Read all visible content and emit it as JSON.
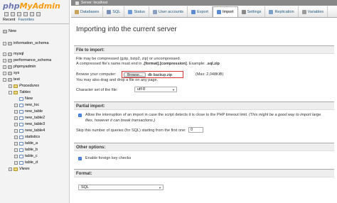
{
  "sidebar": {
    "logo_php": "php",
    "logo_myadmin": "MyAdmin",
    "tab_recent": "Recent",
    "tab_favorites": "Favorites",
    "items": [
      {
        "label": "New",
        "kind": "new"
      },
      {
        "label": "information_schema",
        "kind": "db"
      },
      {
        "label": "mysql",
        "kind": "db"
      },
      {
        "label": "performance_schema",
        "kind": "db"
      },
      {
        "label": "phpmyadmin",
        "kind": "db"
      },
      {
        "label": "sys",
        "kind": "db"
      },
      {
        "label": "test",
        "kind": "db"
      },
      {
        "label": "Procedures",
        "kind": "folder"
      },
      {
        "label": "Tables",
        "kind": "folder"
      },
      {
        "label": "New",
        "kind": "new"
      },
      {
        "label": "new_loc",
        "kind": "table"
      },
      {
        "label": "new_table",
        "kind": "table"
      },
      {
        "label": "new_table2",
        "kind": "table"
      },
      {
        "label": "new_table3",
        "kind": "table"
      },
      {
        "label": "new_table4",
        "kind": "table"
      },
      {
        "label": "statistics",
        "kind": "table"
      },
      {
        "label": "table_a",
        "kind": "table"
      },
      {
        "label": "table_b",
        "kind": "table"
      },
      {
        "label": "table_c",
        "kind": "table"
      },
      {
        "label": "table_d",
        "kind": "table"
      },
      {
        "label": "Views",
        "kind": "folder"
      }
    ]
  },
  "server_bar": "Server: localhost",
  "tabs": [
    {
      "label": "Databases",
      "color": "#c9a55c"
    },
    {
      "label": "SQL",
      "color": "#7a8fb8"
    },
    {
      "label": "Status",
      "color": "#6a9bd8"
    },
    {
      "label": "User accounts",
      "color": "#8aa0c0"
    },
    {
      "label": "Export",
      "color": "#5b8ad0"
    },
    {
      "label": "Import",
      "color": "#5b8ad0"
    },
    {
      "label": "Settings",
      "color": "#888888"
    },
    {
      "label": "Replication",
      "color": "#7aa0c8"
    },
    {
      "label": "Variables",
      "color": "#999999"
    }
  ],
  "main": {
    "title": "Importing into the current server",
    "file_section": {
      "heading": "File to import:",
      "line1": "File may be compressed (gzip, bzip2, zip) or uncompressed.",
      "line2_prefix": "A compressed file's name must end in ",
      "line2_bold": ".[format].[compression]",
      "line2_suffix": ". Example: ",
      "line2_example": ".sql.zip",
      "browse_label": "Browse your computer:",
      "browse_button": "Browse...",
      "file_name": "db backup.zip",
      "max_size": "(Max: 2,048KiB)",
      "drag_note": "You may also drag and drop a file on any page.",
      "charset_label": "Character set of the file:",
      "charset_value": "utf-8"
    },
    "partial_section": {
      "heading": "Partial import:",
      "allow_text": "Allow the interruption of an import in case the script detects it is close to the PHP timeout limit.",
      "allow_italic": " (This might be a good way to import large",
      "allow_line2": "files, however it can break transactions.)",
      "skip_label": "Skip this number of queries (for SQL) starting from the first one:",
      "skip_value": "0"
    },
    "other_section": {
      "heading": "Other options:",
      "fk_label": "Enable foreign key checks"
    },
    "format_section": {
      "heading": "Format:",
      "format_value": "SQL"
    }
  }
}
